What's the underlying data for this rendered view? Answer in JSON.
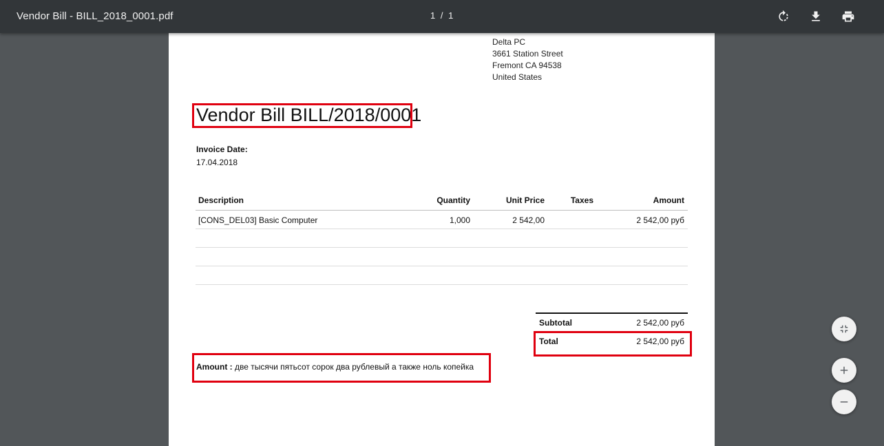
{
  "viewer": {
    "title": "Vendor Bill - BILL_2018_0001.pdf",
    "page_indicator": "1 / 1",
    "icons": {
      "rotate": "rotate-icon",
      "download": "download-icon",
      "print": "print-icon"
    }
  },
  "document": {
    "address": [
      "Delta PC",
      "3661 Station Street",
      "Fremont CA 94538",
      "United States"
    ],
    "title": "Vendor Bill BILL/2018/0001",
    "invoice_date_label": "Invoice Date:",
    "invoice_date": "17.04.2018",
    "table": {
      "headers": {
        "description": "Description",
        "quantity": "Quantity",
        "unit_price": "Unit Price",
        "taxes": "Taxes",
        "amount": "Amount"
      },
      "rows": [
        {
          "description": "[CONS_DEL03] Basic Computer",
          "quantity": "1,000",
          "unit_price": "2 542,00",
          "taxes": "",
          "amount": "2 542,00 руб"
        },
        {
          "description": "",
          "quantity": "",
          "unit_price": "",
          "taxes": "",
          "amount": ""
        },
        {
          "description": "",
          "quantity": "",
          "unit_price": "",
          "taxes": "",
          "amount": ""
        },
        {
          "description": "",
          "quantity": "",
          "unit_price": "",
          "taxes": "",
          "amount": ""
        }
      ]
    },
    "subtotal_label": "Subtotal",
    "subtotal_value": "2 542,00 руб",
    "total_label": "Total",
    "total_value": "2 542,00 руб",
    "amount_label": "Amount :",
    "amount_words": "две тысячи пятьсот сорок два рублевый а также ноль копейка"
  },
  "zoom_controls": {
    "fit": "fit-page-icon",
    "zoom_in": "zoom-in-icon",
    "zoom_out": "zoom-out-icon"
  },
  "colors": {
    "toolbar": "#323639",
    "background": "#525659",
    "highlight": "#e0000f"
  }
}
